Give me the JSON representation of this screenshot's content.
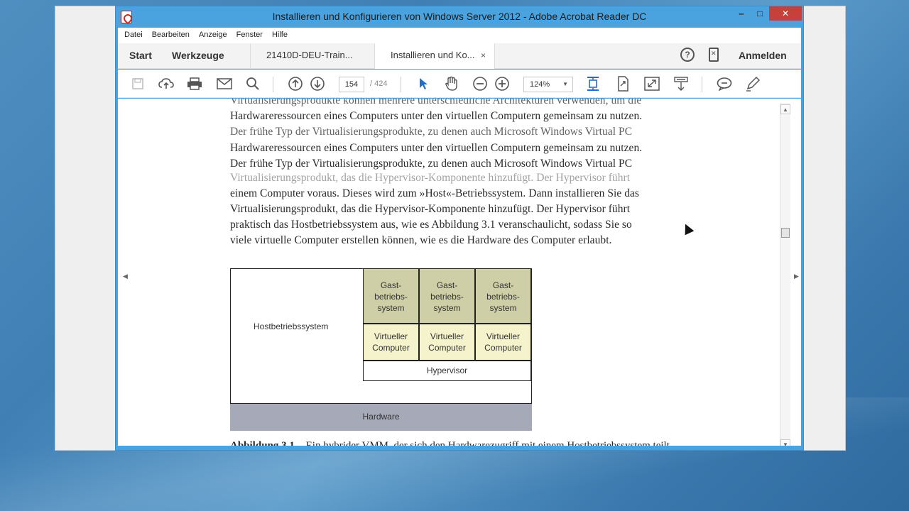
{
  "window": {
    "title": "Installieren und Konfigurieren von Windows Server 2012 - Adobe Acrobat Reader DC",
    "minimize": "‒",
    "maximize": "□",
    "close": "✕"
  },
  "menu": [
    "Datei",
    "Bearbeiten",
    "Anzeige",
    "Fenster",
    "Hilfe"
  ],
  "tabs": {
    "start": "Start",
    "tools": "Werkzeuge",
    "doc1": "21410D-DEU-Train...",
    "doc2": "Installieren und Ko...",
    "close": "×",
    "signin": "Anmelden",
    "help": "?"
  },
  "toolbar": {
    "page_current": "154",
    "page_total": "/ 424",
    "zoom": "124%"
  },
  "document": {
    "lines": [
      "Virtualisierungsprodukte können mehrere unterschiedliche Architekturen verwenden, um die",
      "Hardwareressourcen eines Computers unter den virtuellen Computern gemeinsam zu nutzen.",
      "Der frühe Typ der Virtualisierungsprodukte, zu denen auch Microsoft Windows Virtual PC",
      "Hardwareressourcen eines Computers unter den virtuellen Computern gemeinsam zu nutzen.",
      "Der frühe Typ der Virtualisierungsprodukte, zu denen auch Microsoft Windows Virtual PC",
      "Virtualisierungsprodukt, das die Hypervisor-Komponente hinzufügt. Der Hypervisor führt",
      "einem Computer voraus. Dieses wird zum »Host«-Betriebssystem. Dann installieren Sie das",
      "Virtualisierungsprodukt, das die Hypervisor-Komponente hinzufügt. Der Hypervisor führt",
      "praktisch das Hostbetriebssystem aus, wie es Abbildung 3.1 veranschaulicht, sodass Sie so",
      "viele virtuelle Computer erstellen können, wie es die Hardware des Computer erlaubt."
    ],
    "figure": {
      "host": "Hostbetriebssystem",
      "guest": [
        "Gast-\nbetriebs-\nsystem",
        "Gast-\nbetriebs-\nsystem",
        "Gast-\nbetriebs-\nsystem"
      ],
      "vm": [
        "Virtueller\nComputer",
        "Virtueller\nComputer",
        "Virtueller\nComputer"
      ],
      "hypervisor": "Hypervisor",
      "hardware": "Hardware"
    },
    "caption_label": "Abbildung 3.1",
    "caption_text": "Ein hybrider VMM, der sich den Hardwarezugriff mit einem Hostbetriebssystem teilt"
  },
  "icons": {
    "save": "save-icon",
    "upload": "cloud-upload-icon",
    "print": "print-icon",
    "mail": "mail-icon",
    "search": "search-icon",
    "prev": "prev-page-icon",
    "next": "next-page-icon",
    "select": "select-arrow-icon",
    "hand": "hand-icon",
    "zoom_out": "zoom-out-icon",
    "zoom_in": "zoom-in-icon",
    "fit": "fit-page-icon",
    "rotate": "rotate-icon",
    "fullscreen": "fullscreen-icon",
    "read": "read-mode-icon",
    "comment": "comment-icon",
    "pen": "pen-icon"
  }
}
